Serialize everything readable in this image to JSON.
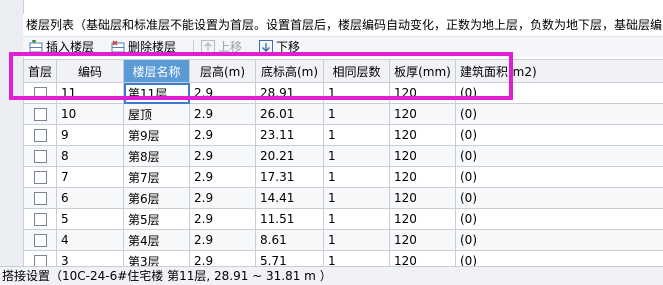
{
  "info": {
    "text": "楼层列表（基础层和标准层不能设置为首层。设置首层后，楼层编码自动变化，正数为地上层，负数为地下层，基础层编"
  },
  "toolbar": {
    "insert_label": "插入楼层",
    "delete_label": "删除楼层",
    "up_label": "上移",
    "down_label": "下移"
  },
  "table": {
    "columns": [
      "首层",
      "编码",
      "楼层名称",
      "层高(m)",
      "底标高(m)",
      "相同层数",
      "板厚(mm)",
      "建筑面积(m2)"
    ],
    "selected_column": "楼层名称",
    "rows": [
      {
        "code": "11",
        "name": "第11层",
        "height": "2.9",
        "base": "28.91",
        "same": "1",
        "thick": "120",
        "area": "(0)"
      },
      {
        "code": "10",
        "name": "屋顶",
        "height": "2.9",
        "base": "26.01",
        "same": "1",
        "thick": "120",
        "area": "(0)"
      },
      {
        "code": "9",
        "name": "第9层",
        "height": "2.9",
        "base": "23.11",
        "same": "1",
        "thick": "120",
        "area": "(0)"
      },
      {
        "code": "8",
        "name": "第8层",
        "height": "2.9",
        "base": "20.21",
        "same": "1",
        "thick": "120",
        "area": "(0)"
      },
      {
        "code": "7",
        "name": "第7层",
        "height": "2.9",
        "base": "17.31",
        "same": "1",
        "thick": "120",
        "area": "(0)"
      },
      {
        "code": "6",
        "name": "第6层",
        "height": "2.9",
        "base": "14.41",
        "same": "1",
        "thick": "120",
        "area": "(0)"
      },
      {
        "code": "5",
        "name": "第5层",
        "height": "2.9",
        "base": "11.51",
        "same": "1",
        "thick": "120",
        "area": "(0)"
      },
      {
        "code": "4",
        "name": "第4层",
        "height": "2.9",
        "base": "8.61",
        "same": "1",
        "thick": "120",
        "area": "(0)"
      },
      {
        "code": "3",
        "name": "第3层",
        "height": "2.9",
        "base": "5.71",
        "same": "1",
        "thick": "120",
        "area": "(0)"
      }
    ]
  },
  "status": {
    "text": "搭接设置（10C-24-6#住宅楼  第11层, 28.91 ~ 31.81 m ）"
  },
  "colors": {
    "highlight": "#e01fd2",
    "selected_header": "#5b9bd5",
    "edit_border": "#3d7bd1"
  }
}
